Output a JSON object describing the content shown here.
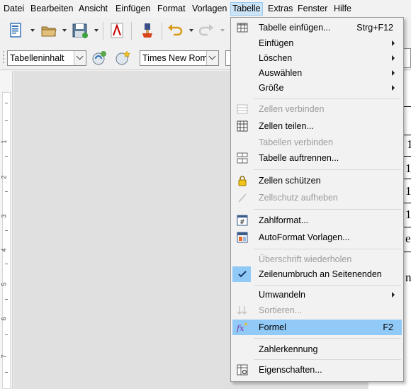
{
  "menubar": {
    "items": [
      "Datei",
      "Bearbeiten",
      "Ansicht",
      "Einfügen",
      "Format",
      "Vorlagen",
      "Tabelle",
      "Extras",
      "Fenster",
      "Hilfe"
    ]
  },
  "toolbar": {
    "paragraph_style": "Tabelleninhalt",
    "font_name": "Times New Roma"
  },
  "document": {
    "ruler_numbers": [
      "1",
      "2",
      "3",
      "4",
      "5",
      "6",
      "7"
    ],
    "visible_chars": [
      "1",
      "1",
      "1",
      "1",
      "1",
      "e",
      "n"
    ]
  },
  "menu": {
    "items": [
      {
        "label": "Tabelle einfügen...",
        "accel": "Strg+F12"
      },
      {
        "label": "Einfügen"
      },
      {
        "label": "Löschen"
      },
      {
        "label": "Auswählen"
      },
      {
        "label": "Größe"
      },
      {
        "label": "Zellen verbinden"
      },
      {
        "label": "Zellen teilen..."
      },
      {
        "label": "Tabellen verbinden"
      },
      {
        "label": "Tabelle auftrennen..."
      },
      {
        "label": "Zellen schützen"
      },
      {
        "label": "Zellschutz aufheben"
      },
      {
        "label": "Zahlformat..."
      },
      {
        "label": "AutoFormat Vorlagen..."
      },
      {
        "label": "Überschrift wiederholen"
      },
      {
        "label": "Zeilenumbruch an Seitenenden"
      },
      {
        "label": "Umwandeln"
      },
      {
        "label": "Sortieren..."
      },
      {
        "label": "Formel",
        "accel": "F2"
      },
      {
        "label": "Zahlerkennung"
      },
      {
        "label": "Eigenschaften..."
      }
    ]
  },
  "colors": {
    "highlight": "#91c9f7",
    "active_menu": "#cce4f7"
  }
}
